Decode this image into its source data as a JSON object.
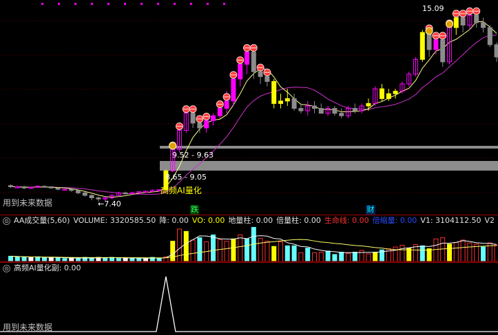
{
  "main_panel": {
    "watermark": "用到未来数据",
    "signal_label": "高频AI量化",
    "range_labels": [
      "9.52 - 9.63",
      "8.65 - 9.05"
    ],
    "high_label": "15.09",
    "low_label": "7.40",
    "arrow_glyph": "←",
    "event_die": "跌",
    "event_cai": "财",
    "colors": {
      "up": "#ff00ff",
      "down_gray": "#8c8c8c",
      "yellow": "#ffff00",
      "ma_short": "#ffff88",
      "ma_long": "#cc33cc"
    }
  },
  "chart_data": {
    "type": "candlestick",
    "ohlc": [
      [
        8.05,
        8.1,
        7.95,
        8.0
      ],
      [
        8.0,
        8.05,
        7.95,
        8.0
      ],
      [
        8.0,
        8.05,
        7.9,
        7.95
      ],
      [
        7.95,
        8.0,
        7.9,
        7.98
      ],
      [
        7.98,
        8.05,
        7.95,
        8.02
      ],
      [
        8.02,
        8.05,
        7.98,
        8.0
      ],
      [
        8.0,
        8.02,
        7.92,
        7.95
      ],
      [
        7.95,
        7.98,
        7.85,
        7.9
      ],
      [
        7.9,
        7.95,
        7.85,
        7.9
      ],
      [
        7.9,
        7.92,
        7.8,
        7.85
      ],
      [
        7.85,
        7.9,
        7.7,
        7.75
      ],
      [
        7.75,
        7.8,
        7.6,
        7.65
      ],
      [
        7.65,
        7.7,
        7.45,
        7.55
      ],
      [
        7.55,
        7.6,
        7.4,
        7.5
      ],
      [
        7.5,
        7.6,
        7.4,
        7.55
      ],
      [
        7.55,
        7.7,
        7.5,
        7.65
      ],
      [
        7.65,
        7.8,
        7.6,
        7.75
      ],
      [
        7.75,
        7.8,
        7.7,
        7.72
      ],
      [
        7.72,
        7.8,
        7.68,
        7.76
      ],
      [
        7.76,
        7.82,
        7.7,
        7.8
      ],
      [
        7.8,
        7.85,
        7.75,
        7.82
      ],
      [
        7.82,
        7.9,
        7.78,
        7.85
      ],
      [
        7.85,
        7.9,
        7.8,
        7.88
      ],
      [
        7.88,
        8.7,
        7.85,
        8.65
      ],
      [
        8.65,
        9.6,
        8.6,
        9.52
      ],
      [
        9.52,
        10.6,
        9.4,
        10.3
      ],
      [
        10.3,
        11.2,
        10.2,
        11.0
      ],
      [
        11.0,
        11.2,
        10.4,
        10.6
      ],
      [
        10.6,
        10.8,
        10.2,
        10.4
      ],
      [
        10.4,
        10.8,
        10.2,
        10.7
      ],
      [
        10.7,
        11.0,
        10.5,
        10.9
      ],
      [
        10.9,
        11.4,
        10.8,
        11.2
      ],
      [
        11.2,
        11.9,
        11.0,
        11.5
      ],
      [
        11.5,
        12.6,
        11.3,
        12.4
      ],
      [
        12.4,
        13.3,
        12.1,
        13.0
      ],
      [
        13.0,
        13.8,
        12.6,
        13.5
      ],
      [
        13.5,
        13.7,
        12.4,
        12.7
      ],
      [
        12.7,
        13.0,
        12.2,
        12.5
      ],
      [
        12.5,
        12.8,
        12.1,
        12.3
      ],
      [
        12.3,
        12.4,
        11.2,
        11.4
      ],
      [
        11.4,
        11.8,
        11.2,
        11.5
      ],
      [
        11.5,
        12.0,
        11.3,
        11.6
      ],
      [
        11.6,
        11.8,
        11.1,
        11.2
      ],
      [
        11.2,
        11.4,
        11.0,
        11.1
      ],
      [
        11.1,
        11.5,
        10.9,
        11.3
      ],
      [
        11.3,
        11.5,
        11.0,
        11.2
      ],
      [
        11.2,
        11.4,
        11.0,
        11.0
      ],
      [
        11.0,
        11.3,
        10.9,
        11.2
      ],
      [
        11.2,
        11.3,
        10.9,
        11.0
      ],
      [
        11.0,
        11.2,
        10.8,
        10.9
      ],
      [
        10.9,
        11.3,
        10.8,
        11.2
      ],
      [
        11.2,
        11.4,
        11.0,
        11.1
      ],
      [
        11.1,
        11.4,
        11.0,
        11.3
      ],
      [
        11.3,
        11.6,
        11.1,
        11.4
      ],
      [
        11.4,
        12.1,
        11.3,
        12.0
      ],
      [
        12.0,
        12.2,
        11.5,
        11.6
      ],
      [
        11.6,
        12.0,
        11.5,
        11.8
      ],
      [
        11.8,
        12.0,
        11.6,
        11.9
      ],
      [
        11.9,
        12.3,
        11.8,
        12.2
      ],
      [
        12.2,
        12.7,
        12.1,
        12.6
      ],
      [
        12.6,
        13.3,
        12.5,
        13.2
      ],
      [
        13.2,
        14.4,
        13.1,
        14.3
      ],
      [
        14.3,
        14.5,
        13.3,
        13.6
      ],
      [
        13.6,
        14.1,
        13.4,
        14.0
      ],
      [
        14.0,
        14.3,
        12.9,
        13.1
      ],
      [
        13.1,
        14.6,
        13.0,
        14.5
      ],
      [
        14.5,
        15.1,
        14.2,
        14.9
      ],
      [
        14.9,
        15.0,
        14.3,
        14.6
      ],
      [
        14.6,
        15.09,
        14.4,
        15.0
      ],
      [
        15.0,
        15.09,
        14.5,
        14.7
      ],
      [
        14.7,
        14.9,
        14.3,
        14.5
      ],
      [
        14.5,
        14.6,
        13.7,
        13.8
      ],
      [
        13.8,
        13.9,
        13.1,
        13.3
      ]
    ],
    "candle_colors": {
      "23": "yellow",
      "36": "gray",
      "39": "yellow",
      "40": "yellow",
      "41": "yellow",
      "53": "yellow",
      "55": "yellow",
      "56": "yellow",
      "57": "yellow",
      "61": "yellow",
      "63": "magenta_fill",
      "66": "yellow"
    },
    "ylim": [
      7.2,
      15.4
    ]
  },
  "volume_panel": {
    "title": "AA成交量(5,60)",
    "volume": {
      "label": "VOLUME:",
      "value": "3320585.50"
    },
    "jiang": {
      "label": "降:",
      "value": "0.00"
    },
    "vo": {
      "label": "VO:",
      "value": "0.00"
    },
    "diliang": {
      "label": "地量柱:",
      "value": "0.00"
    },
    "beiliang": {
      "label": "倍量柱:",
      "value": "0.00"
    },
    "shengming": {
      "label": "生命线:",
      "value": "0.00"
    },
    "beisuo": {
      "label": "倍缩量:",
      "value": "0.00"
    },
    "v1": {
      "label": "V1:",
      "value": "3104112.50"
    },
    "v2": {
      "label": "V2"
    },
    "btn_glyph": "⊙",
    "chart_data": {
      "type": "bar",
      "values": [
        0.9,
        0.8,
        0.7,
        0.7,
        0.8,
        0.6,
        0.7,
        0.6,
        0.5,
        0.6,
        0.5,
        0.7,
        0.6,
        0.7,
        0.6,
        0.7,
        0.5,
        0.6,
        0.5,
        0.6,
        0.5,
        0.7,
        0.6,
        0.8,
        3.5,
        5.6,
        5.2,
        3.7,
        4.1,
        3.4,
        4.6,
        3.8,
        3.5,
        3.9,
        4.6,
        3.9,
        5.9,
        4.0,
        3.5,
        2.6,
        3.4,
        2.7,
        2.7,
        1.5,
        2.3,
        1.5,
        1.6,
        1.8,
        1.2,
        1.6,
        1.4,
        1.6,
        1.9,
        1.3,
        1.6,
        2.0,
        2.2,
        2.5,
        2.8,
        2.3,
        2.9,
        2.7,
        2.2,
        3.9,
        4.1,
        3.0,
        3.3,
        3.7,
        3.2,
        3.0,
        2.5,
        3.2,
        2.8
      ],
      "types": [
        "c",
        "c",
        "c",
        "w",
        "c",
        "c",
        "w",
        "c",
        "c",
        "w",
        "c",
        "c",
        "c",
        "w",
        "c",
        "c",
        "c",
        "w",
        "c",
        "c",
        "w",
        "c",
        "c",
        "r",
        "y",
        "r",
        "y",
        "r",
        "c",
        "r",
        "c",
        "r",
        "r",
        "y",
        "r",
        "c",
        "c",
        "r",
        "r",
        "y",
        "r",
        "c",
        "c",
        "r",
        "c",
        "r",
        "r",
        "c",
        "c",
        "c",
        "r",
        "c",
        "r",
        "r",
        "y",
        "c",
        "r",
        "r",
        "r",
        "y",
        "r",
        "c",
        "y",
        "r",
        "r",
        "y",
        "r",
        "r",
        "r",
        "r",
        "c",
        "r",
        "r"
      ],
      "ylim": [
        0,
        6.2
      ]
    }
  },
  "sub_panel": {
    "title": "高频AI量化副",
    "value": ": 0.00",
    "watermark": "用到未来数据",
    "btn_glyph": "⊙",
    "chart_data": {
      "type": "line",
      "spike_index": 23,
      "spike_value": 1,
      "baseline": 0
    }
  }
}
